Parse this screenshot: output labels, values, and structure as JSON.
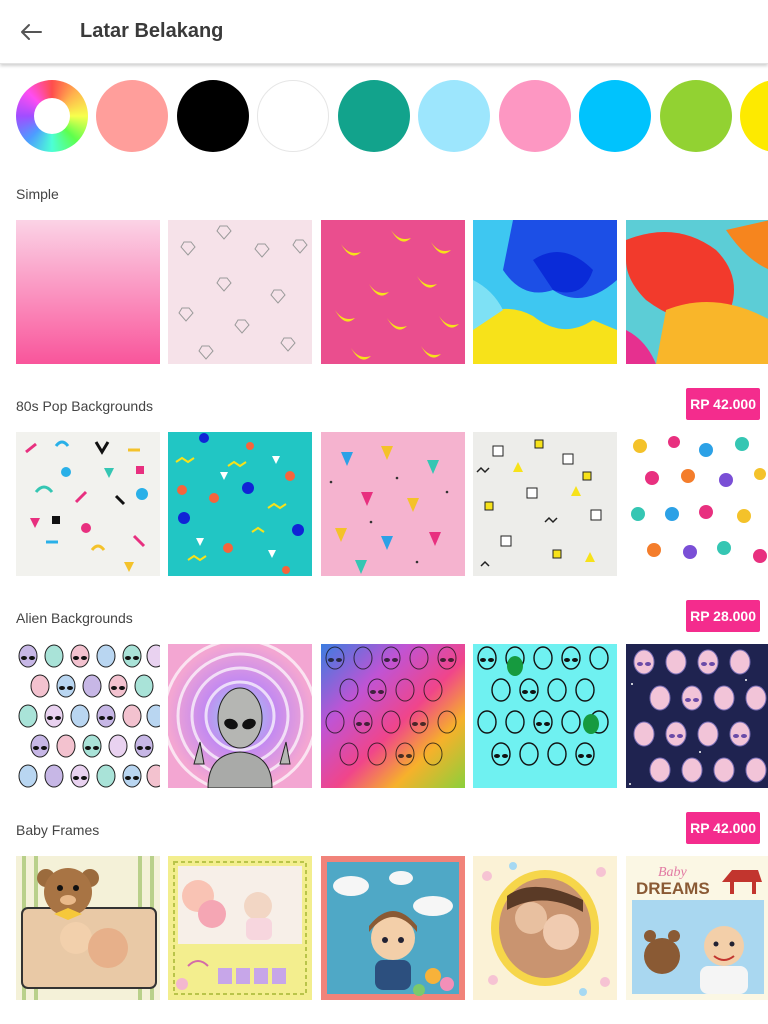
{
  "header": {
    "title": "Latar Belakang",
    "back_icon": "arrow-left-icon"
  },
  "colors": [
    {
      "name": "color-wheel",
      "value": "wheel"
    },
    {
      "name": "salmon",
      "value": "#ff9e9b"
    },
    {
      "name": "black",
      "value": "#000000"
    },
    {
      "name": "white",
      "value": "#ffffff"
    },
    {
      "name": "teal",
      "value": "#12a38c"
    },
    {
      "name": "light-blue",
      "value": "#9de6fd"
    },
    {
      "name": "pink",
      "value": "#fd97c2"
    },
    {
      "name": "sky-blue",
      "value": "#00c3fd"
    },
    {
      "name": "lime",
      "value": "#92d232"
    },
    {
      "name": "yellow",
      "value": "#fdea00"
    }
  ],
  "sections": {
    "simple": {
      "title": "Simple"
    },
    "pop80s": {
      "title": "80s Pop Backgrounds",
      "price": "RP 42.000"
    },
    "alien": {
      "title": "Alien Backgrounds",
      "price": "RP 28.000"
    },
    "baby": {
      "title": "Baby Frames",
      "price": "RP 42.000"
    }
  }
}
